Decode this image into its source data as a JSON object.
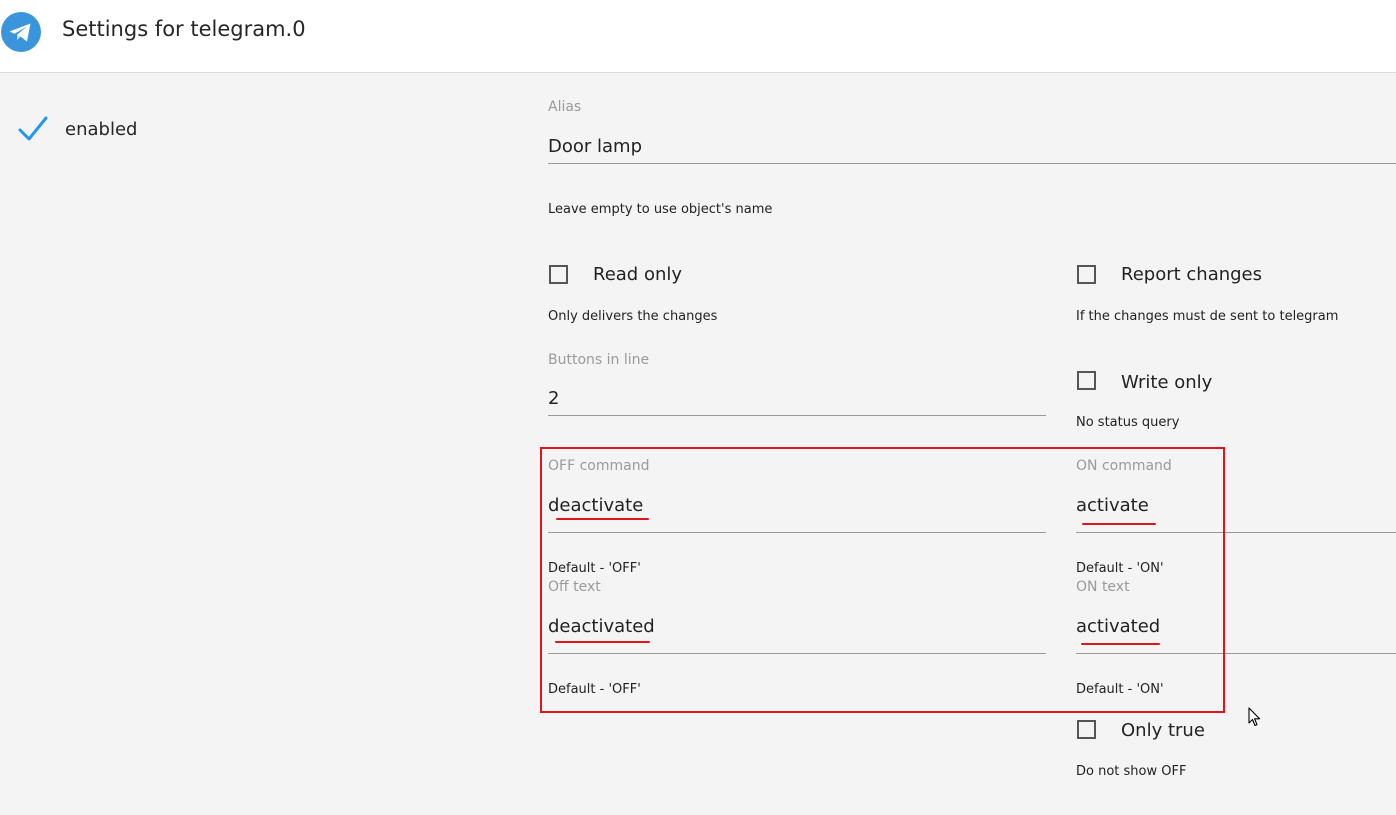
{
  "header": {
    "title": "Settings for telegram.0",
    "logo_icon": "telegram-logo-icon",
    "logo_color": "#3a95dc"
  },
  "enabled": {
    "label": "enabled",
    "checked": true,
    "icon": "checkmark-icon",
    "color": "#2196f3"
  },
  "alias": {
    "label": "Alias",
    "value": "Door lamp",
    "help": "Leave empty to use object's name"
  },
  "read_only": {
    "label": "Read only",
    "checked": false,
    "help": "Only delivers the changes"
  },
  "report_changes": {
    "label": "Report changes",
    "checked": false,
    "help": "If the changes must de sent to telegram"
  },
  "buttons_in_line": {
    "label": "Buttons in line",
    "value": "2"
  },
  "write_only": {
    "label": "Write only",
    "checked": false,
    "help": "No status query"
  },
  "off_command": {
    "label": "OFF command",
    "value": "deactivate",
    "help": "Default - 'OFF'"
  },
  "on_command": {
    "label": "ON command",
    "value": "activate",
    "help": "Default - 'ON'"
  },
  "off_text": {
    "label": "Off text",
    "value": "deactivated",
    "help": "Default - 'OFF'"
  },
  "on_text": {
    "label": "ON text",
    "value": "activated",
    "help": "Default - 'ON'"
  },
  "only_true": {
    "label": "Only true",
    "checked": false,
    "help": "Do not show OFF"
  },
  "annotation_color": "#e0161e"
}
